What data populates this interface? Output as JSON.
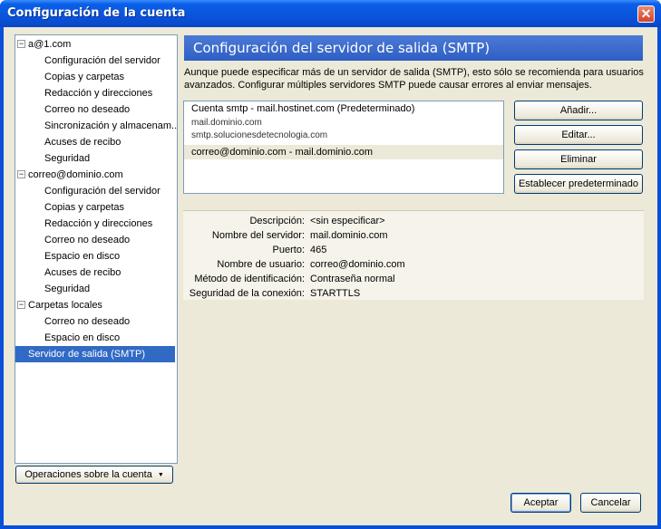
{
  "window": {
    "title": "Configuración de la cuenta"
  },
  "tree": [
    {
      "label": "a@1.com",
      "level": 0,
      "expanded": true
    },
    {
      "label": "Configuración del servidor",
      "level": 1
    },
    {
      "label": "Copias y carpetas",
      "level": 1
    },
    {
      "label": "Redacción y direcciones",
      "level": 1
    },
    {
      "label": "Correo no deseado",
      "level": 1
    },
    {
      "label": "Sincronización y almacenam...",
      "level": 1
    },
    {
      "label": "Acuses de recibo",
      "level": 1
    },
    {
      "label": "Seguridad",
      "level": 1
    },
    {
      "label": "correo@dominio.com",
      "level": 0,
      "expanded": true
    },
    {
      "label": "Configuración del servidor",
      "level": 1
    },
    {
      "label": "Copias y carpetas",
      "level": 1
    },
    {
      "label": "Redacción y direcciones",
      "level": 1
    },
    {
      "label": "Correo no deseado",
      "level": 1
    },
    {
      "label": "Espacio en disco",
      "level": 1
    },
    {
      "label": "Acuses de recibo",
      "level": 1
    },
    {
      "label": "Seguridad",
      "level": 1
    },
    {
      "label": "Carpetas locales",
      "level": 0,
      "expanded": true
    },
    {
      "label": "Correo no deseado",
      "level": 1
    },
    {
      "label": "Espacio en disco",
      "level": 1
    },
    {
      "label": "Servidor de salida (SMTP)",
      "level": 0,
      "selected": true
    }
  ],
  "account_ops_label": "Operaciones sobre la cuenta",
  "panel": {
    "header": "Configuración del servidor de salida (SMTP)",
    "description": "Aunque puede especificar más de un servidor de salida (SMTP), esto sólo se recomienda para usuarios avanzados. Configurar múltiples servidores SMTP puede causar errores al enviar mensajes."
  },
  "smtp_list": {
    "item1": "Cuenta smtp - mail.hostinet.com (Predeterminado)",
    "item1_sub1": "mail.dominio.com",
    "item1_sub2": "smtp.solucionesdetecnologia.com",
    "item2": "correo@dominio.com - mail.dominio.com"
  },
  "buttons": {
    "add": "Añadir...",
    "edit": "Editar...",
    "delete": "Eliminar",
    "set_default": "Establecer predeterminado"
  },
  "details": [
    {
      "label": "Descripción:",
      "value": "<sin especificar>"
    },
    {
      "label": "Nombre del servidor:",
      "value": "mail.dominio.com"
    },
    {
      "label": "Puerto:",
      "value": "465"
    },
    {
      "label": "Nombre de usuario:",
      "value": "correo@dominio.com"
    },
    {
      "label": "Método de identificación:",
      "value": "Contraseña normal"
    },
    {
      "label": "Seguridad de la conexión:",
      "value": "STARTTLS"
    }
  ],
  "footer": {
    "accept": "Aceptar",
    "cancel": "Cancelar"
  },
  "colors": {
    "selection": "#316ac5",
    "titlebar": "#0a54dc",
    "close": "#d3442a"
  }
}
